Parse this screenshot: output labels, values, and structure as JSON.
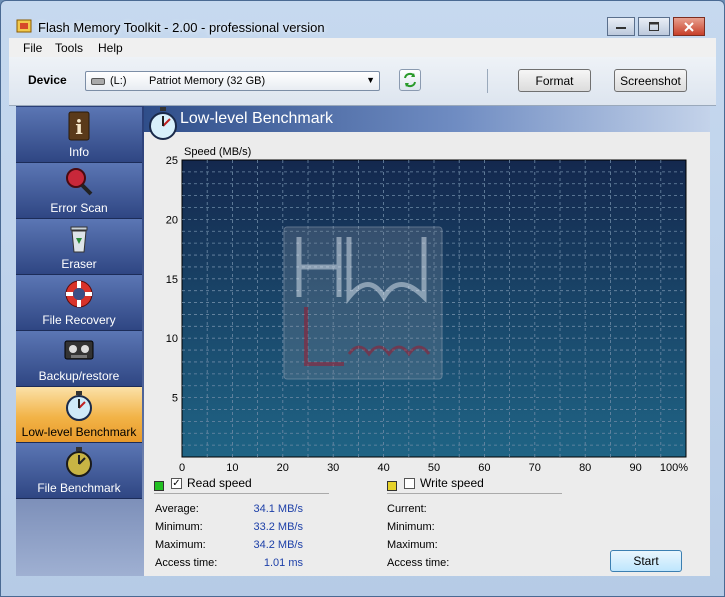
{
  "window": {
    "title": "Flash Memory Toolkit - 2.00 - professional version"
  },
  "menu": [
    "File",
    "Tools",
    "Help"
  ],
  "toolbar": {
    "device_label": "Device",
    "drive_letter": "(L:)",
    "drive_name": "Patriot Memory (32 GB)",
    "format_label": "Format",
    "screenshot_label": "Screenshot"
  },
  "sidebar": {
    "items": [
      {
        "label": "Info",
        "icon": "info-icon"
      },
      {
        "label": "Error Scan",
        "icon": "magnifier-icon"
      },
      {
        "label": "Eraser",
        "icon": "recycle-bin-icon"
      },
      {
        "label": "File Recovery",
        "icon": "lifebuoy-icon"
      },
      {
        "label": "Backup/restore",
        "icon": "tape-icon"
      },
      {
        "label": "Low-level Benchmark",
        "icon": "stopwatch-icon",
        "active": true
      },
      {
        "label": "File Benchmark",
        "icon": "stopwatch-dark-icon"
      }
    ]
  },
  "header": {
    "title": "Low-level Benchmark"
  },
  "chart_data": {
    "type": "line",
    "ylabel": "Speed (MB/s)",
    "xlabel": "",
    "ylim": [
      0,
      25
    ],
    "xlim": [
      0,
      100
    ],
    "y_ticks": [
      "5",
      "10",
      "15",
      "20",
      "25"
    ],
    "x_ticks": [
      "0",
      "10",
      "20",
      "30",
      "40",
      "50",
      "60",
      "70",
      "80",
      "90",
      "100%"
    ],
    "grid": true,
    "series": [],
    "colors": {
      "bg_top": "#14284e",
      "bg_bottom": "#1f6485",
      "grid": "#6e8aa6"
    }
  },
  "read": {
    "legend": "Read speed",
    "checked": true,
    "color": "#22c022",
    "average_label": "Average:",
    "average_value": "34.1 MB/s",
    "minimum_label": "Minimum:",
    "minimum_value": "33.2 MB/s",
    "maximum_label": "Maximum:",
    "maximum_value": "34.2 MB/s",
    "access_label": "Access time:",
    "access_value": "1.01 ms"
  },
  "write": {
    "legend": "Write speed",
    "checked": false,
    "color": "#e6d22a",
    "current_label": "Current:",
    "minimum_label": "Minimum:",
    "maximum_label": "Maximum:",
    "access_label": "Access time:"
  },
  "start_label": "Start"
}
